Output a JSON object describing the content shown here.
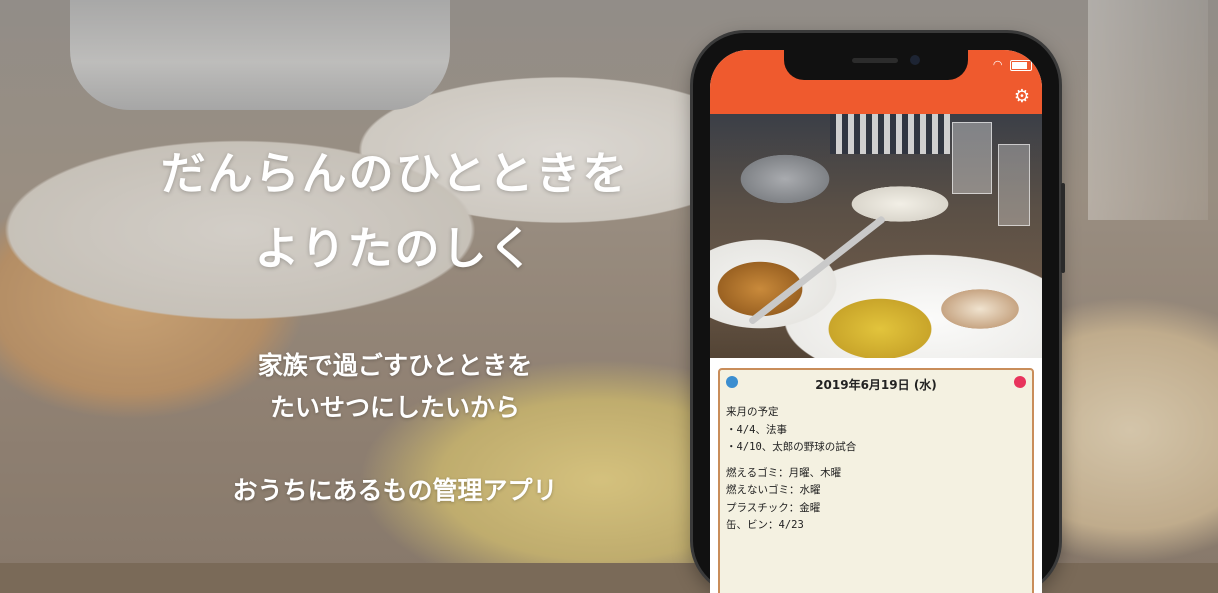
{
  "hero": {
    "title_line1": "だんらんのひとときを",
    "title_line2": "よりたのしく",
    "sub_line1": "家族で過ごすひとときを",
    "sub_line2": "たいせつにしたいから",
    "tagline": "おうちにあるもの管理アプリ"
  },
  "phone": {
    "appbar_color": "#ef5a2e",
    "settings_icon": "gear-icon",
    "status_icons": [
      "wifi-icon",
      "battery-icon"
    ]
  },
  "note": {
    "date": "2019年6月19日 (水)",
    "left_dot_color": "#3b8ed0",
    "right_dot_color": "#e8345c",
    "lines_group1": [
      "来月の予定",
      "・4/4、法事",
      "・4/10、太郎の野球の試合"
    ],
    "lines_group2": [
      "燃えるゴミ：月曜、木曜",
      "燃えないゴミ：水曜",
      "プラスチック：金曜",
      "缶、ビン：4/23"
    ]
  }
}
